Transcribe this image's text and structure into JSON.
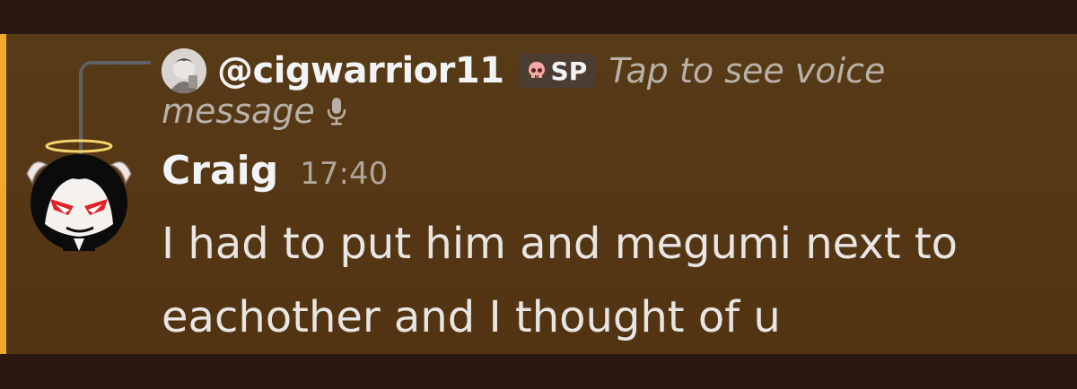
{
  "reply": {
    "username": "@cigwarrior11",
    "badge_text": "SP",
    "badge_icon": "skull-icon",
    "preview_part1": "Tap to see voice",
    "preview_part2": "message",
    "preview_icon": "microphone-icon"
  },
  "message": {
    "author": "Craig",
    "timestamp": "17:40",
    "text": "I had to put him and megumi next to eachother and I thought of u"
  },
  "colors": {
    "highlight_bar": "#f0a92a",
    "message_background": "#563815",
    "username": "#f2f3f5",
    "muted_text": "#b9b1a8",
    "message_text": "#e8e5e2"
  }
}
